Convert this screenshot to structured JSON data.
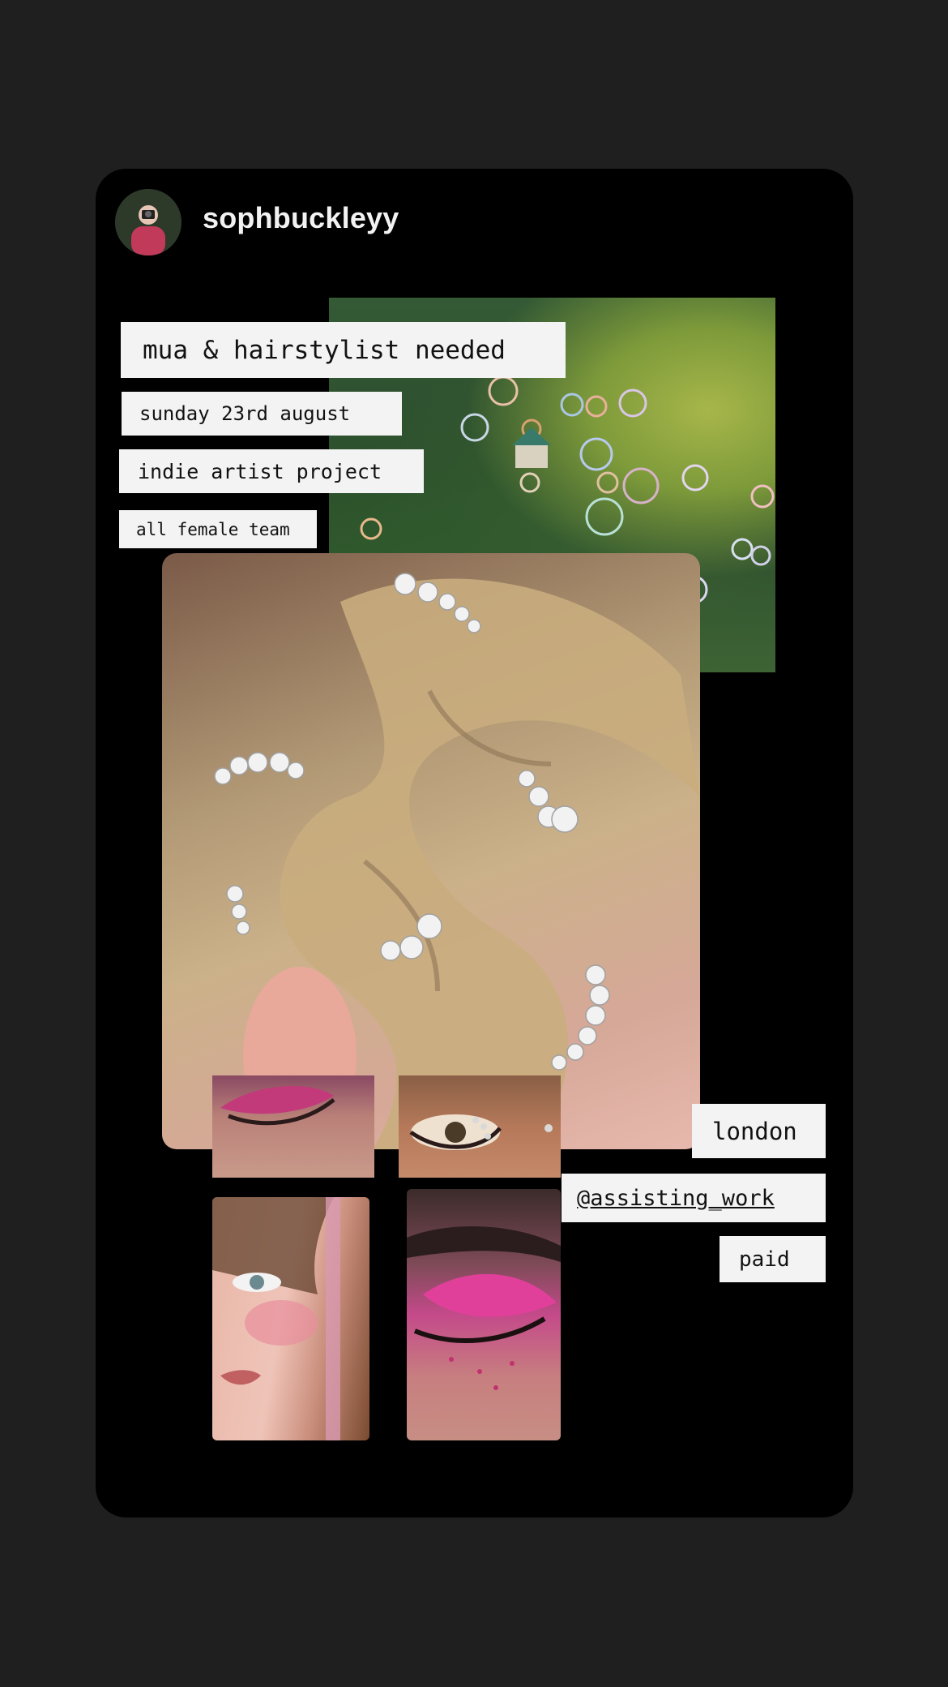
{
  "header": {
    "username": "sophbuckleyy"
  },
  "post": {
    "title": "mua & hairstylist needed",
    "date": "sunday 23rd august",
    "project": "indie artist project",
    "team": "all female team",
    "location": "london",
    "contact": "@assisting_work",
    "payment": "paid"
  }
}
